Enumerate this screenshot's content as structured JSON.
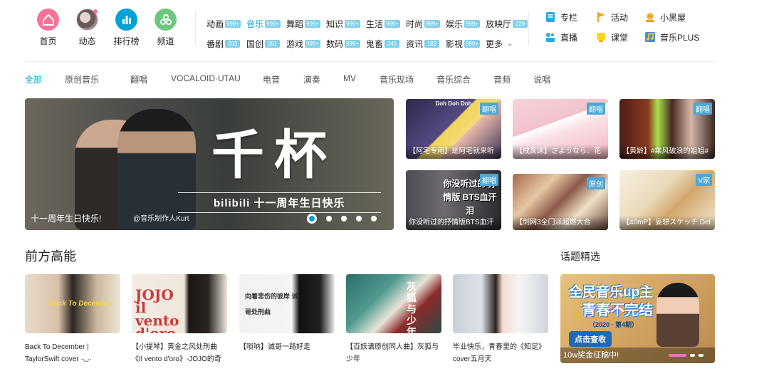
{
  "top_nav": {
    "items": [
      {
        "label": "首页",
        "icon": "home-icon",
        "color": "#fb7299"
      },
      {
        "label": "动态",
        "icon": "avatar"
      },
      {
        "label": "排行榜",
        "icon": "bar-chart-icon",
        "color": "#00a1d6"
      },
      {
        "label": "频道",
        "icon": "channel-icon",
        "color": "#6dc781"
      }
    ],
    "categories_row1": [
      {
        "label": "动画",
        "count": "999+"
      },
      {
        "label": "音乐",
        "count": "999+",
        "active": true
      },
      {
        "label": "舞蹈",
        "count": "999+"
      },
      {
        "label": "知识",
        "count": "999+"
      },
      {
        "label": "生活",
        "count": "999+"
      },
      {
        "label": "时尚",
        "count": "999+"
      },
      {
        "label": "娱乐",
        "count": "999+"
      },
      {
        "label": "放映厅",
        "count": "229"
      }
    ],
    "categories_row2": [
      {
        "label": "番剧",
        "count": "203"
      },
      {
        "label": "国创",
        "count": "351"
      },
      {
        "label": "游戏",
        "count": "999+"
      },
      {
        "label": "数码",
        "count": "999+"
      },
      {
        "label": "鬼畜",
        "count": "245"
      },
      {
        "label": "资讯",
        "count": "182"
      },
      {
        "label": "影视",
        "count": "999+"
      },
      {
        "label": "更多"
      }
    ],
    "extras": [
      {
        "label": "专栏",
        "icon": "article-icon"
      },
      {
        "label": "活动",
        "icon": "flag-icon"
      },
      {
        "label": "小黑屋",
        "icon": "judge-icon"
      },
      {
        "label": "直播",
        "icon": "live-icon"
      },
      {
        "label": "课堂",
        "icon": "classroom-icon"
      },
      {
        "label": "音乐PLUS",
        "icon": "music-plus-icon"
      }
    ]
  },
  "tabs": [
    "全部",
    "原创音乐",
    "翻唱",
    "VOCALOID·UTAU",
    "电音",
    "演奏",
    "MV",
    "音乐现场",
    "音乐综合",
    "音频",
    "说唱"
  ],
  "banner": {
    "title": "千杯",
    "subtitle": "bilibili 十一周年生日快乐",
    "caption": "十一周年生日快乐!",
    "watermark": "@音乐制作人Kurt",
    "dot_count": 5,
    "current_dot": 0
  },
  "thumbs": [
    {
      "caption": "【阿宅专用】是阿宅就来听",
      "badge": "翻唱",
      "top_text": "Doh Doh Doh"
    },
    {
      "caption": "【戌亥床】さようなら、花",
      "badge": "翻唱"
    },
    {
      "caption": "【黄龄】#乘风破浪的姐姐#",
      "badge": "翻唱"
    },
    {
      "caption": "你没听过的抒情版BTS血汗",
      "badge": "翻唱",
      "image_text": "你没听过的 抒情版 BTS血汗泪"
    },
    {
      "caption": "【剑网3全门派超燃大合",
      "badge": "原创"
    },
    {
      "caption": "【40mP】妄想スケッチ Del",
      "badge": "V家"
    }
  ],
  "section_main": {
    "title": "前方高能",
    "videos": [
      {
        "title": "Back To December | TaylorSwift cover ·◡·",
        "image_text": "Back To December"
      },
      {
        "title": "【小提琴】黄金之风处刑曲《Il vento d'oro》-JOJO的奇妙冒",
        "image_text": "JOJO il vento d'oro"
      },
      {
        "title": "【唢呐】诚哥一路好走",
        "image_text": "向着悲伤的彼岸 诚哥处刑曲"
      },
      {
        "title": "【百妖谱原创同人曲】灰狐与少年",
        "image_text": "灰狐与少年"
      },
      {
        "title": "毕业快乐，青春里的《知足》cover五月天"
      }
    ]
  },
  "section_topic": {
    "title": "话题精选",
    "card": {
      "headline1": "全民音乐up主",
      "headline2": "青春不完结",
      "issue": "（2020 · 第4期）",
      "cta": "点击查收",
      "caption": "10w奖金征稿中!",
      "dot_count": 3,
      "current_dot": 0
    }
  },
  "colors": {
    "accent": "#00a1d6",
    "pink": "#fb7299",
    "count_badge": "#7fd0ea",
    "thumb_badge": "#4da7d5"
  }
}
